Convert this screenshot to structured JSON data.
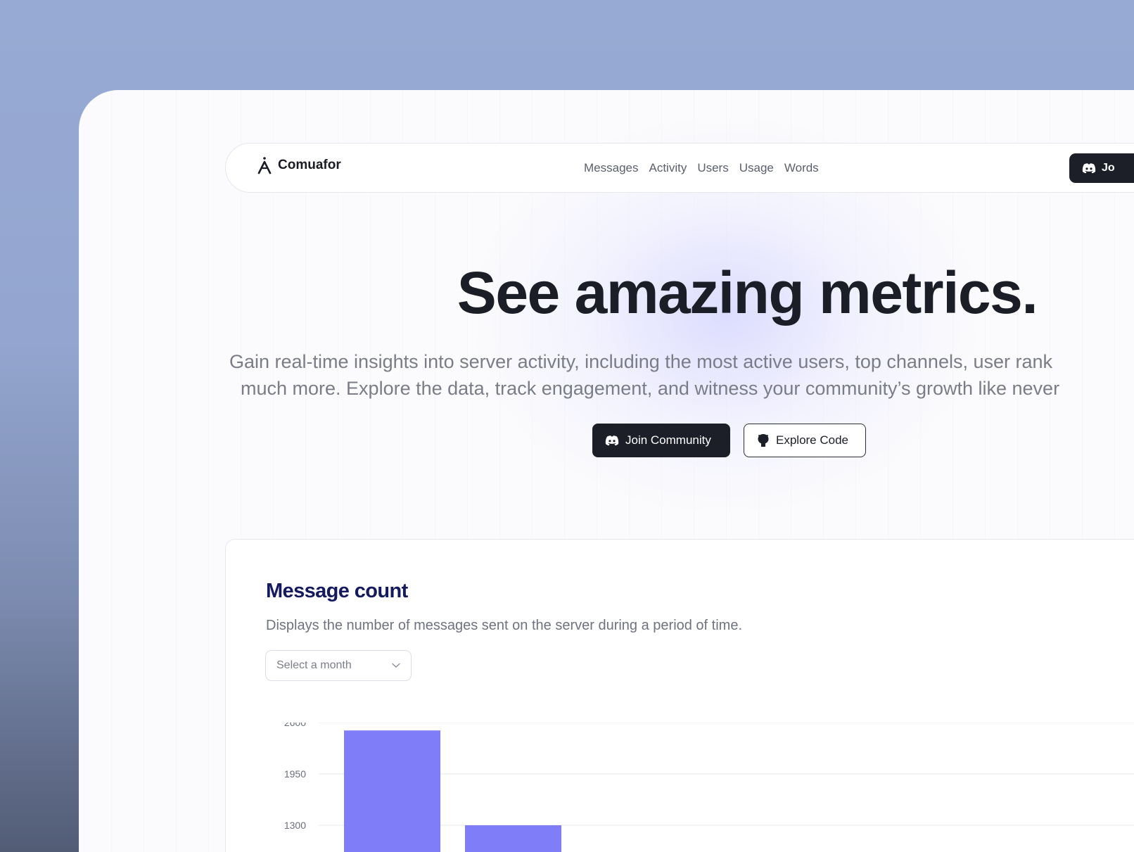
{
  "navbar": {
    "brand_name": "Comuafor",
    "links": [
      "Messages",
      "Activity",
      "Users",
      "Usage",
      "Words"
    ],
    "join_label": "Jo"
  },
  "hero": {
    "title": "See amazing metrics.",
    "subtitle_line1": "Gain real-time insights into server activity, including the most active users, top channels, user rank",
    "subtitle_line2": "much more. Explore the data, track engagement, and witness your community’s growth like never",
    "join_button": "Join Community",
    "explore_button": "Explore Code"
  },
  "card": {
    "title": "Message count",
    "description": "Displays the number of messages sent on the server during a period of time.",
    "select_placeholder": "Select a month"
  },
  "colors": {
    "bar": "#7f7df7",
    "title_navy": "#141a5e",
    "dark_button": "#1c1f27"
  },
  "icons": {
    "brand": "brand-a-icon",
    "discord": "discord-icon",
    "github": "github-icon",
    "chevron": "chevron-down-icon"
  },
  "chart_data": {
    "type": "bar",
    "title": "",
    "xlabel": "",
    "ylabel": "",
    "y_ticks": [
      2600,
      1950,
      1300
    ],
    "ylim": [
      0,
      2600
    ],
    "categories": [
      "",
      ""
    ],
    "values": [
      2500,
      1300
    ],
    "grid": true,
    "note_visible_range": [
      1250,
      2600
    ]
  }
}
